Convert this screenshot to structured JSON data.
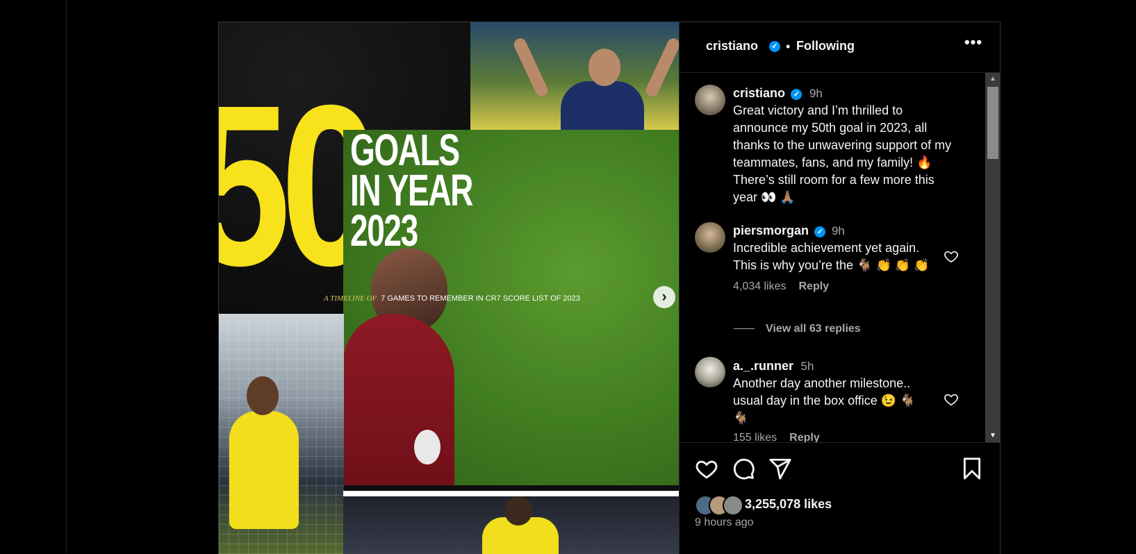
{
  "post": {
    "media": {
      "big_number": "50",
      "title_lines": "GOALS\nIN YEAR\n2023",
      "timeline_prefix": "A TIMELINE OF",
      "timeline_text": "7 GAMES TO REMEMBER IN CR7 SCORE LIST OF 2023",
      "next_icon": "chevron-right-icon"
    },
    "header": {
      "username": "cristiano",
      "separator": "•",
      "follow_status": "Following",
      "more_icon": "more-horizontal-icon"
    },
    "caption": {
      "username": "cristiano",
      "time": "9h",
      "text": "Great victory and I’m thrilled to\nannounce my 50th goal in 2023, all\nthanks to the unwavering support of my\nteammates, fans, and my family! 🔥\nThere’s still room for a few more this\nyear 👀 🙏🏽"
    },
    "comments": [
      {
        "username": "piersmorgan",
        "verified": true,
        "time": "9h",
        "text": "Incredible achievement yet again.\nThis is why you’re the 🐐 👏 👏 👏",
        "likes": "4,034 likes",
        "reply_label": "Reply",
        "view_replies": "View all 63 replies"
      },
      {
        "username": "a._.runner",
        "verified": false,
        "time": "5h",
        "text": "Another day another milestone..\nusual day in the box office 😉 🐐\n🐐",
        "likes": "155 likes",
        "reply_label": "Reply"
      }
    ],
    "actions": {
      "like_icon": "heart-icon",
      "comment_icon": "comment-icon",
      "share_icon": "send-icon",
      "save_icon": "bookmark-icon"
    },
    "likes_count": "3,255,078 likes",
    "time_ago": "9 hours ago",
    "colors": {
      "accent_yellow": "#f7e21b",
      "verified_blue": "#0095f6",
      "muted_text": "#a8a8a8",
      "background": "#000000"
    }
  }
}
